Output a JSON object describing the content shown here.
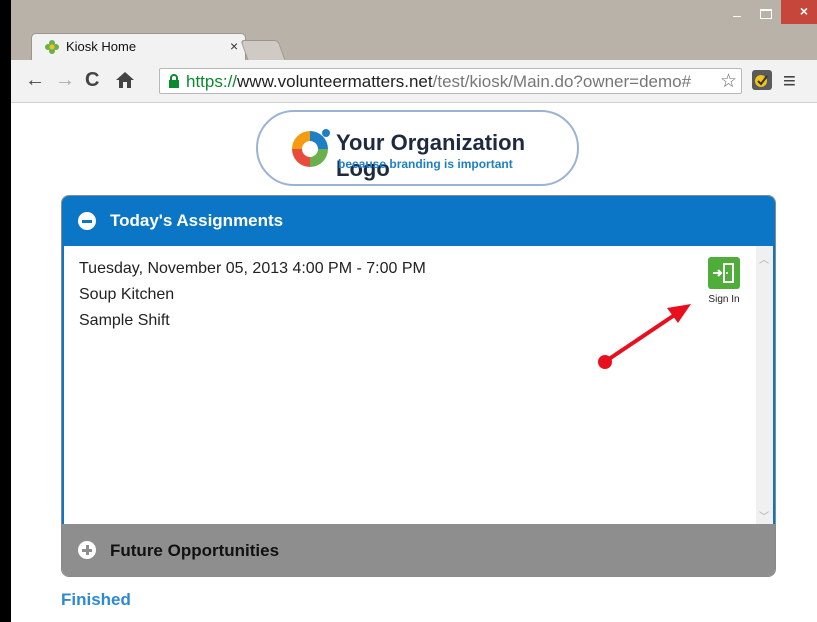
{
  "browser": {
    "tab_title": "Kiosk Home",
    "tab_close": "×",
    "window_controls": {
      "minimize": "–",
      "close": "×"
    },
    "url_protocol": "https://",
    "url_host": "www.volunteermatters.net",
    "url_path": "/test/kiosk/Main.do?owner=demo#",
    "icons": [
      "back-icon",
      "forward-icon",
      "reload-icon",
      "home-icon",
      "lock-icon",
      "star-icon",
      "extension-icon",
      "menu-icon"
    ]
  },
  "logo": {
    "title": "Your Organization Logo",
    "tagline": "because branding is important"
  },
  "todays_assignments": {
    "title": "Today's Assignments",
    "date_time": "Tuesday, November 05, 2013 4:00 PM - 7:00 PM",
    "location": "Soup Kitchen",
    "shift": "Sample Shift",
    "sign_in_label": "Sign In"
  },
  "future_opportunities": {
    "title": "Future Opportunities"
  },
  "footer": {
    "finished_link": "Finished"
  },
  "colors": {
    "header_blue": "#0b76c5",
    "future_gray": "#8e8e8e",
    "sign_in_green": "#4fae3a",
    "link_blue": "#2d8ad0",
    "annotation_red": "#e8101e"
  }
}
